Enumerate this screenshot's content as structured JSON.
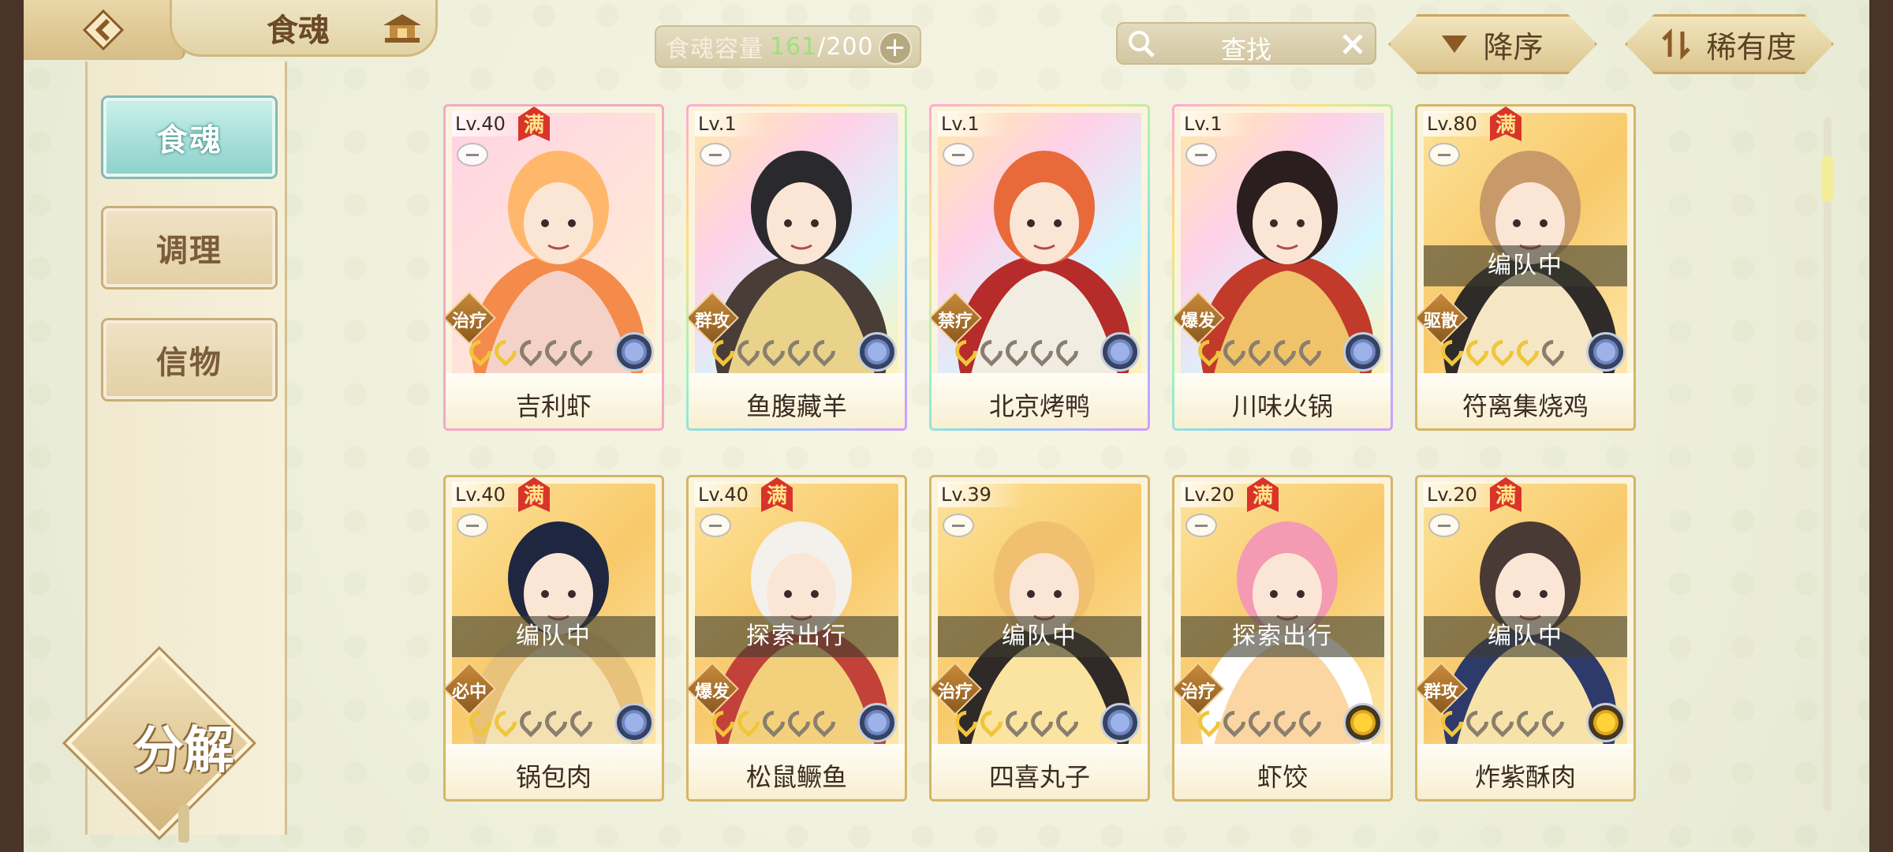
{
  "header": {
    "title": "食魂",
    "capacity_label": "食魂容量",
    "capacity_current": "161",
    "capacity_max": "/200",
    "capacity_plus": "+",
    "search_text": "查找",
    "sort_order_label": "降序",
    "sort_key_label": "稀有度"
  },
  "sidebar": {
    "items": [
      {
        "label": "食魂",
        "active": true
      },
      {
        "label": "调理",
        "active": false
      },
      {
        "label": "信物",
        "active": false
      }
    ],
    "decompose_label": "分解"
  },
  "cards": [
    {
      "level": "Lv.40",
      "full": "满",
      "role": "治疗",
      "name": "吉利虾",
      "status": "",
      "stars": 2,
      "element": "blue",
      "frame": "pink"
    },
    {
      "level": "Lv.1",
      "full": "",
      "role": "群攻",
      "name": "鱼腹藏羊",
      "status": "",
      "stars": 1,
      "element": "blue",
      "frame": "rainbow"
    },
    {
      "level": "Lv.1",
      "full": "",
      "role": "禁疗",
      "name": "北京烤鸭",
      "status": "",
      "stars": 1,
      "element": "blue",
      "frame": "rainbow"
    },
    {
      "level": "Lv.1",
      "full": "",
      "role": "爆发",
      "name": "川味火锅",
      "status": "",
      "stars": 1,
      "element": "blue",
      "frame": "rainbow"
    },
    {
      "level": "Lv.80",
      "full": "满",
      "role": "驱散",
      "name": "符离集烧鸡",
      "status": "编队中",
      "stars": 4,
      "element": "blue",
      "frame": "gold"
    },
    {
      "level": "Lv.40",
      "full": "满",
      "role": "必中",
      "name": "锅包肉",
      "status": "编队中",
      "stars": 2,
      "element": "blue",
      "frame": "gold"
    },
    {
      "level": "Lv.40",
      "full": "满",
      "role": "爆发",
      "name": "松鼠鳜鱼",
      "status": "探索出行",
      "stars": 2,
      "element": "blue",
      "frame": "gold"
    },
    {
      "level": "Lv.39",
      "full": "",
      "role": "治疗",
      "name": "四喜丸子",
      "status": "编队中",
      "stars": 2,
      "element": "blue",
      "frame": "gold"
    },
    {
      "level": "Lv.20",
      "full": "满",
      "role": "治疗",
      "name": "虾饺",
      "status": "探索出行",
      "stars": 1,
      "element": "gold",
      "frame": "gold"
    },
    {
      "level": "Lv.20",
      "full": "满",
      "role": "群攻",
      "name": "炸紫酥肉",
      "status": "编队中",
      "stars": 1,
      "element": "gold",
      "frame": "gold"
    }
  ]
}
